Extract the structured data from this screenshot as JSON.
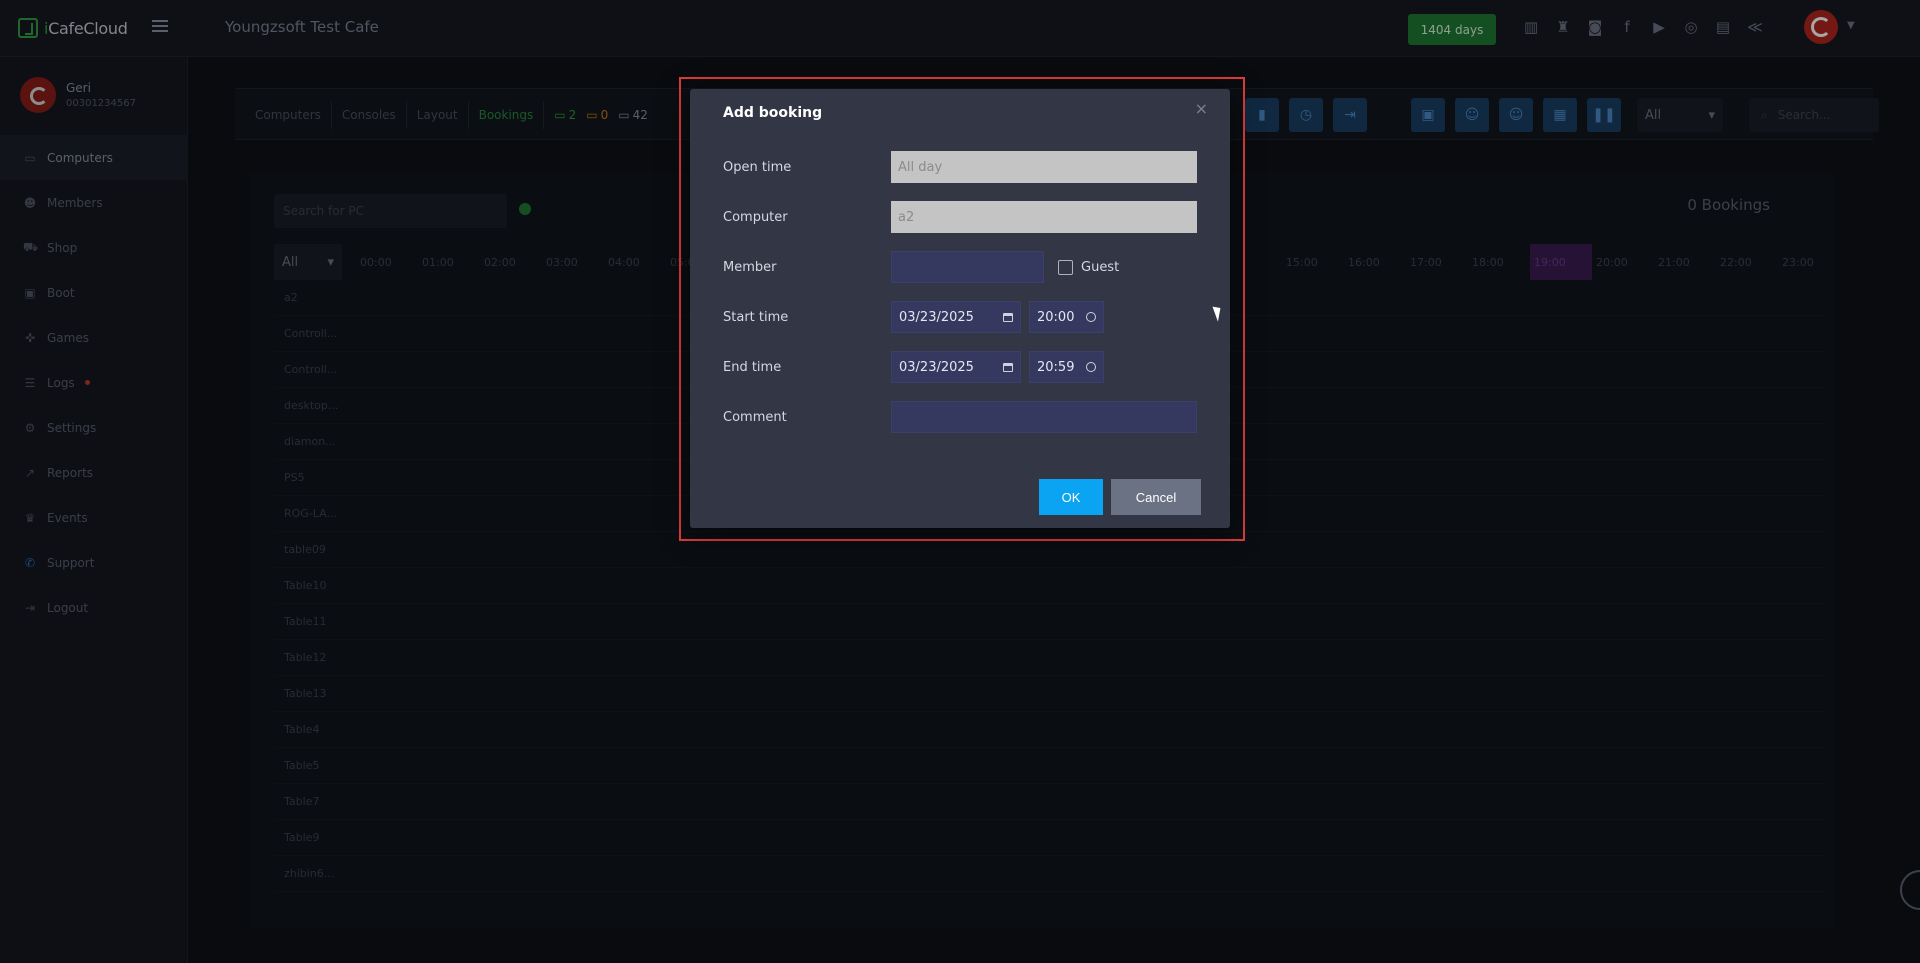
{
  "app": {
    "brand_prefix": "i",
    "brand_name": "CafeCloud",
    "cafe_title": "Youngzsoft Test Cafe",
    "days_badge": "1404 days"
  },
  "user": {
    "name": "Geri",
    "phone": "00301234567"
  },
  "sidebar": {
    "items": [
      {
        "label": "Computers",
        "icon": "monitor-icon"
      },
      {
        "label": "Members",
        "icon": "users-icon"
      },
      {
        "label": "Shop",
        "icon": "cart-icon"
      },
      {
        "label": "Boot",
        "icon": "boot-icon"
      },
      {
        "label": "Games",
        "icon": "gamepad-icon"
      },
      {
        "label": "Logs",
        "icon": "list-icon"
      },
      {
        "label": "Settings",
        "icon": "gear-icon"
      },
      {
        "label": "Reports",
        "icon": "chart-icon"
      },
      {
        "label": "Events",
        "icon": "crown-icon"
      },
      {
        "label": "Support",
        "icon": "phone-icon"
      },
      {
        "label": "Logout",
        "icon": "logout-icon"
      }
    ]
  },
  "tabs": [
    "Computers",
    "Consoles",
    "Layout",
    "Bookings"
  ],
  "counts": {
    "green": "2",
    "orange": "0",
    "total": "42"
  },
  "toolbar": {
    "filter_value": "All",
    "search_placeholder": "Search..."
  },
  "bookings": {
    "search_placeholder": "Search for PC",
    "count_label": "0 Bookings",
    "filter_value": "All",
    "hours": [
      "00:00",
      "01:00",
      "02:00",
      "03:00",
      "04:00",
      "05:00",
      "15:00",
      "16:00",
      "17:00",
      "18:00",
      "19:00",
      "20:00",
      "21:00",
      "22:00",
      "23:00"
    ],
    "rows": [
      "a2",
      "Controll...",
      "Controll...",
      "desktop...",
      "diamon...",
      "PS5",
      "ROG-LA...",
      "table09",
      "Table10",
      "Table11",
      "Table12",
      "Table13",
      "Table4",
      "Table5",
      "Table7",
      "Table9",
      "zhibin6..."
    ]
  },
  "modal": {
    "title": "Add booking",
    "close": "×",
    "open_time_label": "Open time",
    "open_time_value": "All day",
    "computer_label": "Computer",
    "computer_value": "a2",
    "member_label": "Member",
    "member_value": "",
    "guest_label": "Guest",
    "start_time_label": "Start time",
    "start_date": "03/23/2025",
    "start_time": "20:00",
    "end_time_label": "End time",
    "end_date": "03/23/2025",
    "end_time": "20:59",
    "comment_label": "Comment",
    "comment_value": "",
    "ok_label": "OK",
    "cancel_label": "Cancel"
  },
  "colors": {
    "accent": "#0aa4f2",
    "brand": "#2ea043",
    "highlight": "#e03a3a",
    "modal_bg": "#323645"
  }
}
